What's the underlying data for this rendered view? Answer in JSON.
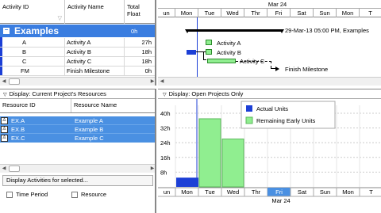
{
  "activity_table": {
    "columns": [
      "Activity ID",
      "Activity Name",
      "Total Float"
    ],
    "group": {
      "label": "Examples",
      "float": "0h"
    },
    "rows": [
      {
        "id": "A",
        "name": "Activity A",
        "float": "27h"
      },
      {
        "id": "B",
        "name": "Activity B",
        "float": "18h"
      },
      {
        "id": "C",
        "name": "Activity C",
        "float": "18h"
      },
      {
        "id": "FM",
        "name": "Finish Milestone",
        "float": "0h"
      }
    ]
  },
  "gantt": {
    "month": "Mar 24",
    "days": [
      "un",
      "Mon",
      "Tue",
      "Wed",
      "Thr",
      "Fri",
      "Sat",
      "Sun",
      "Mon",
      "T"
    ],
    "summary_label": "29-Mar-13 05:00 PM, Examples",
    "bars": [
      {
        "label": "Activity A"
      },
      {
        "label": "Activity B"
      },
      {
        "label": "Activity C"
      },
      {
        "label": "Finish Milestone"
      }
    ]
  },
  "resources": {
    "display_label": "Display: Current Project's Resources",
    "columns": [
      "Resource ID",
      "Resource Name"
    ],
    "rows": [
      {
        "id": "EX.A",
        "name": "Example A"
      },
      {
        "id": "EX.B",
        "name": "Example B"
      },
      {
        "id": "EX.C",
        "name": "Example C"
      }
    ],
    "display_activities": "Display Activities for selected...",
    "time_period": "Time Period",
    "resource": "Resource"
  },
  "histogram": {
    "display_label": "Display: Open Projects Only",
    "month": "Mar 24",
    "days": [
      "un",
      "Mon",
      "Tue",
      "Wed",
      "Thr",
      "Fri",
      "Sat",
      "Sun",
      "Mon",
      "T"
    ],
    "highlight_day": "Fri",
    "legend": [
      "Actual Units",
      "Remaining Early Units"
    ],
    "colors": {
      "actual": "#1c3fd6",
      "remaining": "#90ee90",
      "highlight": "#4a90e2"
    },
    "chart_data": {
      "type": "bar",
      "categories": [
        "un",
        "Mon",
        "Tue",
        "Wed",
        "Thr",
        "Fri",
        "Sat",
        "Sun",
        "Mon",
        "T"
      ],
      "ylim": [
        0,
        40
      ],
      "yticks": [
        "40h",
        "32h",
        "24h",
        "16h",
        "8h"
      ],
      "series": [
        {
          "name": "Actual Units",
          "values": [
            0,
            5,
            0,
            0,
            0,
            0,
            0,
            0,
            0,
            0
          ]
        },
        {
          "name": "Remaining Early Units",
          "values": [
            0,
            0,
            37,
            26,
            0,
            0,
            0,
            0,
            0,
            0
          ]
        }
      ]
    }
  }
}
